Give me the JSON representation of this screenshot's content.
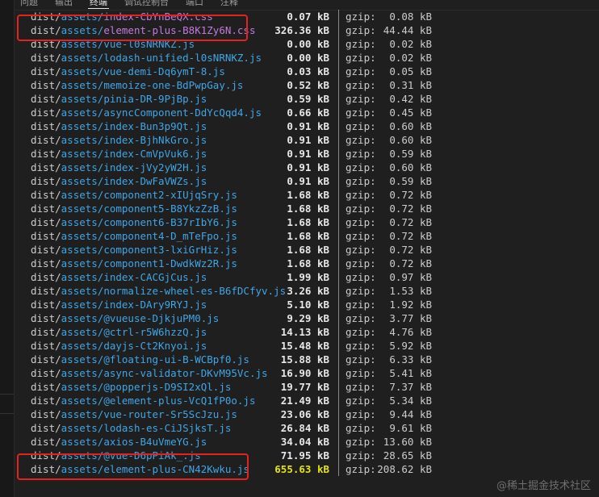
{
  "panel": {
    "tabs": [
      {
        "label": "问题"
      },
      {
        "label": "输出"
      },
      {
        "label": "终端",
        "active": true
      },
      {
        "label": "调试控制台"
      },
      {
        "label": "端口"
      },
      {
        "label": "注释"
      }
    ]
  },
  "output": {
    "dir": "dist/",
    "assets": "assets/",
    "gzip_label": "gzip:",
    "rows": [
      {
        "file": "index-CbYnBeQX.css",
        "size": "0.07 kB",
        "gzip": "0.08 kB",
        "css": true
      },
      {
        "file": "element-plus-B8K1Zy6N.css",
        "size": "326.36 kB",
        "gzip": "44.44 kB",
        "css": true,
        "highlighted": true
      },
      {
        "file": "vue-l0sNRNKZ.js",
        "size": "0.00 kB",
        "gzip": "0.02 kB"
      },
      {
        "file": "lodash-unified-l0sNRNKZ.js",
        "size": "0.00 kB",
        "gzip": "0.02 kB"
      },
      {
        "file": "vue-demi-Dq6ymT-8.js",
        "size": "0.03 kB",
        "gzip": "0.05 kB"
      },
      {
        "file": "memoize-one-BdPwpGay.js",
        "size": "0.52 kB",
        "gzip": "0.31 kB"
      },
      {
        "file": "pinia-DR-9PjBp.js",
        "size": "0.59 kB",
        "gzip": "0.42 kB"
      },
      {
        "file": "asyncComponent-DdYcQqd4.js",
        "size": "0.66 kB",
        "gzip": "0.45 kB"
      },
      {
        "file": "index-Bun3p9Qt.js",
        "size": "0.91 kB",
        "gzip": "0.60 kB"
      },
      {
        "file": "index-BjhNkGro.js",
        "size": "0.91 kB",
        "gzip": "0.60 kB"
      },
      {
        "file": "index-CmVpVuk6.js",
        "size": "0.91 kB",
        "gzip": "0.59 kB"
      },
      {
        "file": "index-jVy2yW2H.js",
        "size": "0.91 kB",
        "gzip": "0.60 kB"
      },
      {
        "file": "index-DwFaVWZs.js",
        "size": "0.91 kB",
        "gzip": "0.59 kB"
      },
      {
        "file": "component2-xIUjqSry.js",
        "size": "1.68 kB",
        "gzip": "0.72 kB"
      },
      {
        "file": "component5-B8YkzZzB.js",
        "size": "1.68 kB",
        "gzip": "0.72 kB"
      },
      {
        "file": "component6-B37rIbY6.js",
        "size": "1.68 kB",
        "gzip": "0.72 kB"
      },
      {
        "file": "component4-D_mTeFpo.js",
        "size": "1.68 kB",
        "gzip": "0.72 kB"
      },
      {
        "file": "component3-lxiGrHiz.js",
        "size": "1.68 kB",
        "gzip": "0.72 kB"
      },
      {
        "file": "component1-DwdkWz2R.js",
        "size": "1.68 kB",
        "gzip": "0.72 kB"
      },
      {
        "file": "index-CACGjCus.js",
        "size": "1.99 kB",
        "gzip": "0.97 kB"
      },
      {
        "file": "normalize-wheel-es-B6fDCfyv.js",
        "size": "3.26 kB",
        "gzip": "1.53 kB"
      },
      {
        "file": "index-DAry9RYJ.js",
        "size": "5.10 kB",
        "gzip": "1.92 kB"
      },
      {
        "file": "@vueuse-DjkjuPM0.js",
        "size": "9.29 kB",
        "gzip": "3.77 kB"
      },
      {
        "file": "@ctrl-r5W6hzzQ.js",
        "size": "14.13 kB",
        "gzip": "4.76 kB"
      },
      {
        "file": "dayjs-Ct2Knyoi.js",
        "size": "15.48 kB",
        "gzip": "5.92 kB"
      },
      {
        "file": "@floating-ui-B-WCBpf0.js",
        "size": "15.88 kB",
        "gzip": "6.33 kB"
      },
      {
        "file": "async-validator-DKvM95Vc.js",
        "size": "16.90 kB",
        "gzip": "5.41 kB"
      },
      {
        "file": "@popperjs-D9SI2xQl.js",
        "size": "19.77 kB",
        "gzip": "7.37 kB"
      },
      {
        "file": "@element-plus-VcQ1fP0o.js",
        "size": "21.49 kB",
        "gzip": "5.34 kB"
      },
      {
        "file": "vue-router-Sr5ScJzu.js",
        "size": "23.06 kB",
        "gzip": "9.44 kB"
      },
      {
        "file": "lodash-es-CiJSjksT.js",
        "size": "26.84 kB",
        "gzip": "9.61 kB"
      },
      {
        "file": "axios-B4uVmeYG.js",
        "size": "34.04 kB",
        "gzip": "13.60 kB"
      },
      {
        "file": "@vue-D6pPiAk_.js",
        "size": "71.95 kB",
        "gzip": "28.65 kB"
      },
      {
        "file": "element-plus-CN42Kwku.js",
        "size": "655.63 kB",
        "gzip": "208.62 kB",
        "warn": true,
        "highlighted": true
      }
    ]
  },
  "colors": {
    "background": "#1f1f1f",
    "path": "#3fa6e8",
    "css_file": "#c678dd",
    "warning_size": "#e5e510",
    "highlight_box": "#e32222"
  },
  "watermark": "@稀土掘金技术社区"
}
